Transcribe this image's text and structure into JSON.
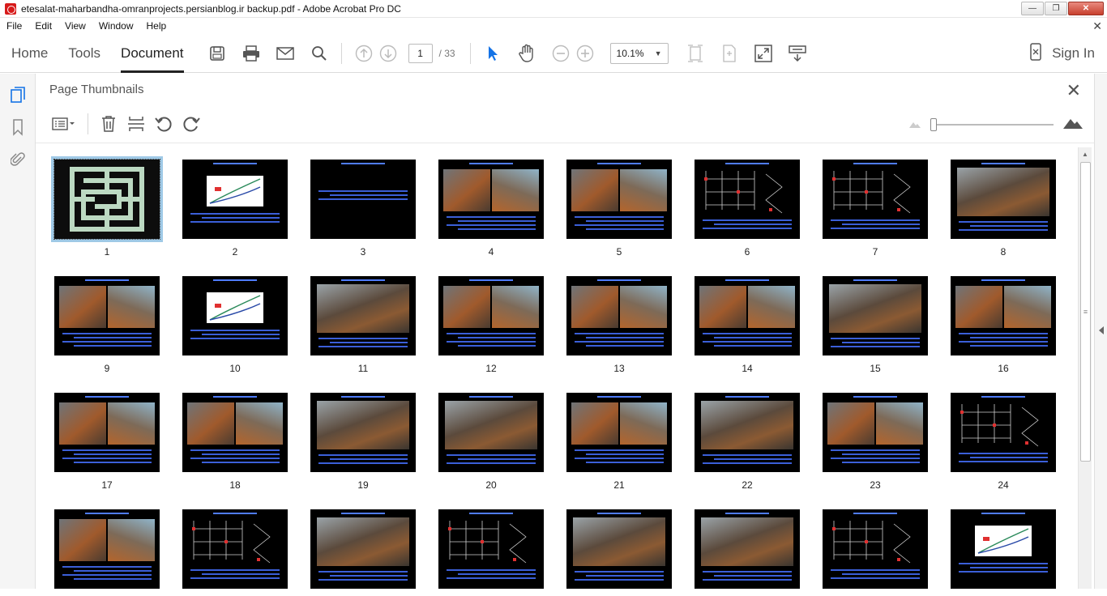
{
  "window": {
    "title": "etesalat-maharbandha-omranprojects.persianblog.ir backup.pdf - Adobe Acrobat Pro DC",
    "buttons": [
      "minimize",
      "restore",
      "close"
    ]
  },
  "menu": [
    "File",
    "Edit",
    "View",
    "Window",
    "Help"
  ],
  "toolbar": {
    "tabs": [
      "Home",
      "Tools",
      "Document"
    ],
    "active_tab": "Document",
    "current_page": "1",
    "total_pages": "/ 33",
    "zoom": "10.1%",
    "sign_in": "Sign In"
  },
  "panel": {
    "title": "Page Thumbnails"
  },
  "colors": {
    "accent": "#1473e6",
    "thumb_bg": "#000000",
    "thumb_text": "#3b6cff",
    "selection": "#9fc9e6"
  },
  "thumbnails": [
    {
      "n": "1",
      "kind": "logo",
      "selected": true
    },
    {
      "n": "2",
      "kind": "chart"
    },
    {
      "n": "3",
      "kind": "text"
    },
    {
      "n": "4",
      "kind": "photo2"
    },
    {
      "n": "5",
      "kind": "photo2"
    },
    {
      "n": "6",
      "kind": "diagram"
    },
    {
      "n": "7",
      "kind": "diagram"
    },
    {
      "n": "8",
      "kind": "photo1"
    },
    {
      "n": "9",
      "kind": "photo2"
    },
    {
      "n": "10",
      "kind": "chart"
    },
    {
      "n": "11",
      "kind": "photo1"
    },
    {
      "n": "12",
      "kind": "photo2"
    },
    {
      "n": "13",
      "kind": "photo2"
    },
    {
      "n": "14",
      "kind": "photo2"
    },
    {
      "n": "15",
      "kind": "photo1"
    },
    {
      "n": "16",
      "kind": "photo2"
    },
    {
      "n": "17",
      "kind": "photo2"
    },
    {
      "n": "18",
      "kind": "photo2"
    },
    {
      "n": "19",
      "kind": "photo1"
    },
    {
      "n": "20",
      "kind": "photo1"
    },
    {
      "n": "21",
      "kind": "photo2"
    },
    {
      "n": "22",
      "kind": "photo1"
    },
    {
      "n": "23",
      "kind": "photo2"
    },
    {
      "n": "24",
      "kind": "diagram"
    },
    {
      "n": "",
      "kind": "photo2"
    },
    {
      "n": "",
      "kind": "diagram"
    },
    {
      "n": "",
      "kind": "photo1"
    },
    {
      "n": "",
      "kind": "diagram"
    },
    {
      "n": "",
      "kind": "photo1"
    },
    {
      "n": "",
      "kind": "photo1"
    },
    {
      "n": "",
      "kind": "diagram"
    },
    {
      "n": "",
      "kind": "chart"
    }
  ]
}
